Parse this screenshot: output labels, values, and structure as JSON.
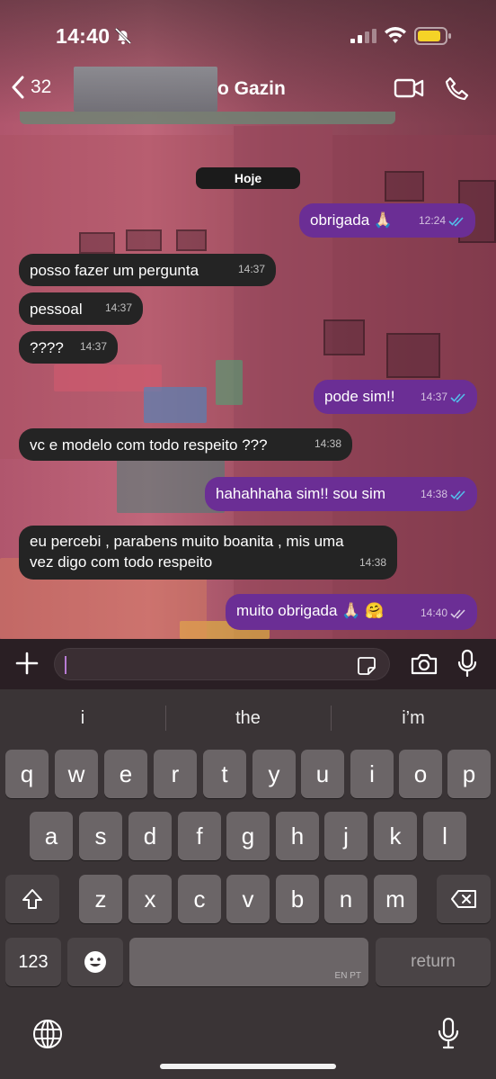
{
  "status_bar": {
    "time": "14:40"
  },
  "header": {
    "back_count": "32",
    "contact_name_visible": "o Gazin"
  },
  "chat": {
    "date_label": "Hoje",
    "messages": [
      {
        "dir": "out",
        "text": "obrigada 🙏🏻",
        "time": "12:24"
      },
      {
        "dir": "in",
        "text": "posso fazer um pergunta",
        "time": "14:37"
      },
      {
        "dir": "in",
        "text": "pessoal",
        "time": "14:37"
      },
      {
        "dir": "in",
        "text": "????",
        "time": "14:37"
      },
      {
        "dir": "out",
        "text": "pode sim!!",
        "time": "14:37"
      },
      {
        "dir": "in",
        "text": "vc e modelo com todo respeito ???",
        "time": "14:38"
      },
      {
        "dir": "out",
        "text": "hahahhaha sim!! sou sim",
        "time": "14:38"
      },
      {
        "dir": "in",
        "text_line1": "eu percebi , parabens muito boanita , mis uma",
        "text_line2": "vez digo com todo respeito",
        "time": "14:38"
      },
      {
        "dir": "out",
        "text": "muito obrigada 🙏🏻 🤗",
        "time": "14:40"
      }
    ]
  },
  "input": {
    "placeholder": ""
  },
  "keyboard": {
    "suggestions": [
      "i",
      "the",
      "i’m"
    ],
    "row1": [
      "q",
      "w",
      "e",
      "r",
      "t",
      "y",
      "u",
      "i",
      "o",
      "p"
    ],
    "row2": [
      "a",
      "s",
      "d",
      "f",
      "g",
      "h",
      "j",
      "k",
      "l"
    ],
    "row3": [
      "z",
      "x",
      "c",
      "v",
      "b",
      "n",
      "m"
    ],
    "numbers_key": "123",
    "space_lang": "EN PT",
    "return_key": "return"
  },
  "colors": {
    "outgoing_bubble": "#6b2e95",
    "incoming_bubble": "#242424",
    "read_ticks": "#53bdeb"
  }
}
